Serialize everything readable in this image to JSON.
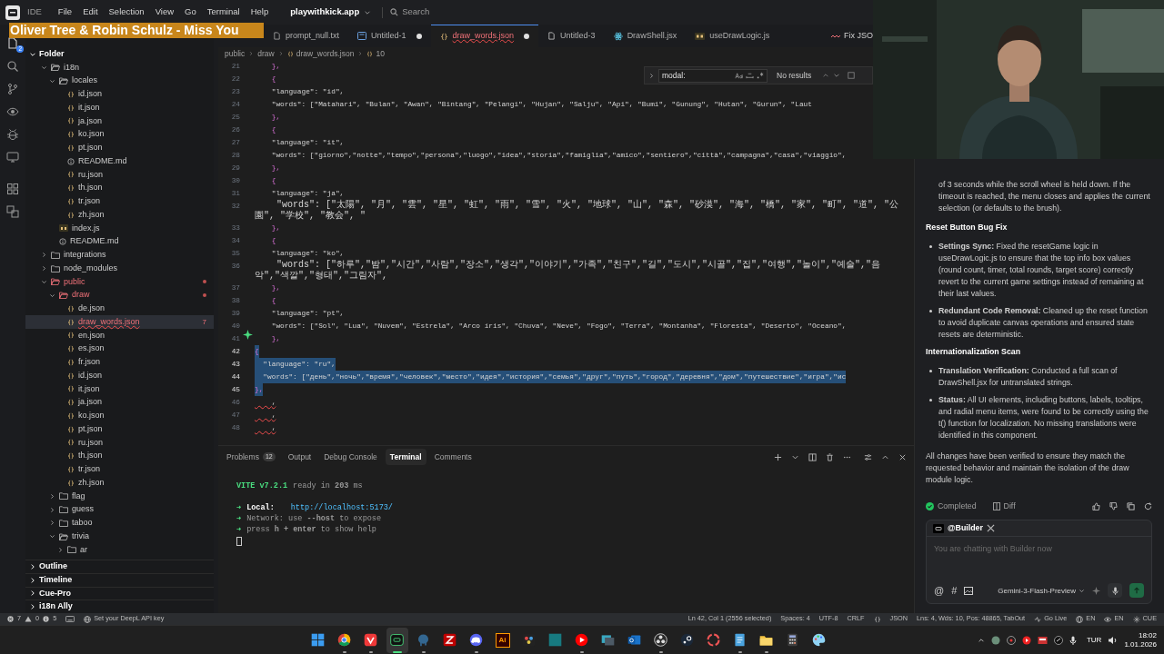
{
  "title_bar": {
    "app_name": "IDE",
    "menus": [
      "File",
      "Edit",
      "Selection",
      "View",
      "Go",
      "Terminal",
      "Help"
    ],
    "workspace": "playwithkick.app",
    "search": {
      "placeholder": "Search"
    }
  },
  "now_playing": {
    "text": "Oliver Tree & Robin Schulz - Miss You"
  },
  "activity_bar": {
    "explorer_badge": "2"
  },
  "sidebar": {
    "title": "Folder",
    "tree": [
      {
        "label": "i18n",
        "kind": "folder",
        "expanded": true,
        "selected": false,
        "error": false,
        "children": [
          {
            "label": "locales",
            "kind": "folder",
            "expanded": true,
            "selected": false,
            "error": false,
            "children": [
              {
                "label": "id.json",
                "kind": "json",
                "selected": false,
                "error": false
              },
              {
                "label": "it.json",
                "kind": "json",
                "selected": false,
                "error": false
              },
              {
                "label": "ja.json",
                "kind": "json",
                "selected": false,
                "error": false
              },
              {
                "label": "ko.json",
                "kind": "json",
                "selected": false,
                "error": false
              },
              {
                "label": "pt.json",
                "kind": "json",
                "selected": false,
                "error": false
              },
              {
                "label": "README.md",
                "kind": "md",
                "selected": false,
                "error": false
              },
              {
                "label": "ru.json",
                "kind": "json",
                "selected": false,
                "error": false
              },
              {
                "label": "th.json",
                "kind": "json",
                "selected": false,
                "error": false
              },
              {
                "label": "tr.json",
                "kind": "json",
                "selected": false,
                "error": false
              },
              {
                "label": "zh.json",
                "kind": "json",
                "selected": false,
                "error": false
              }
            ]
          },
          {
            "label": "index.js",
            "kind": "js",
            "selected": false,
            "error": false
          },
          {
            "label": "README.md",
            "kind": "md",
            "selected": false,
            "error": false
          }
        ]
      },
      {
        "label": "integrations",
        "kind": "folder",
        "expanded": false,
        "selected": false,
        "error": false
      },
      {
        "label": "node_modules",
        "kind": "folder",
        "expanded": false,
        "selected": false,
        "error": false
      },
      {
        "label": "public",
        "kind": "folder",
        "expanded": true,
        "selected": false,
        "error": true,
        "children": [
          {
            "label": "draw",
            "kind": "folder",
            "expanded": true,
            "selected": false,
            "error": true,
            "children": [
              {
                "label": "de.json",
                "kind": "json",
                "selected": false,
                "error": false
              },
              {
                "label": "draw_words.json",
                "kind": "json",
                "selected": true,
                "error": true,
                "badge": "7"
              },
              {
                "label": "en.json",
                "kind": "json",
                "selected": false,
                "error": false
              },
              {
                "label": "es.json",
                "kind": "json",
                "selected": false,
                "error": false
              },
              {
                "label": "fr.json",
                "kind": "json",
                "selected": false,
                "error": false
              },
              {
                "label": "id.json",
                "kind": "json",
                "selected": false,
                "error": false
              },
              {
                "label": "it.json",
                "kind": "json",
                "selected": false,
                "error": false
              },
              {
                "label": "ja.json",
                "kind": "json",
                "selected": false,
                "error": false
              },
              {
                "label": "ko.json",
                "kind": "json",
                "selected": false,
                "error": false
              },
              {
                "label": "pt.json",
                "kind": "json",
                "selected": false,
                "error": false
              },
              {
                "label": "ru.json",
                "kind": "json",
                "selected": false,
                "error": false
              },
              {
                "label": "th.json",
                "kind": "json",
                "selected": false,
                "error": false
              },
              {
                "label": "tr.json",
                "kind": "json",
                "selected": false,
                "error": false
              },
              {
                "label": "zh.json",
                "kind": "json",
                "selected": false,
                "error": false
              }
            ]
          },
          {
            "label": "flag",
            "kind": "folder",
            "expanded": false,
            "selected": false,
            "error": false
          },
          {
            "label": "guess",
            "kind": "folder",
            "expanded": false,
            "selected": false,
            "error": false
          },
          {
            "label": "taboo",
            "kind": "folder",
            "expanded": false,
            "selected": false,
            "error": false
          },
          {
            "label": "trivia",
            "kind": "folder",
            "expanded": true,
            "selected": false,
            "error": false,
            "children": [
              {
                "label": "ar",
                "kind": "folder",
                "expanded": false,
                "selected": false,
                "error": false
              }
            ]
          }
        ]
      }
    ],
    "sections": [
      "Outline",
      "Timeline",
      "Cue-Pro",
      "i18n Ally"
    ]
  },
  "tabs": [
    {
      "label": "prompt_null.txt",
      "kind": "txt",
      "selected": false,
      "modified": false,
      "error": false
    },
    {
      "label": "Untitled-1",
      "kind": "untitled",
      "selected": false,
      "modified": true,
      "error": false
    },
    {
      "label": "draw_words.json",
      "kind": "json",
      "selected": true,
      "modified": true,
      "error": true
    },
    {
      "label": "Untitled-3",
      "kind": "file",
      "selected": false,
      "modified": false,
      "error": false
    },
    {
      "label": "DrawShell.jsx",
      "kind": "react",
      "selected": false,
      "modified": false,
      "error": false
    },
    {
      "label": "useDrawLogic.js",
      "kind": "js",
      "selected": false,
      "modified": false,
      "error": false
    }
  ],
  "tab_bar_action": "Fix JSO",
  "breadcrumb": [
    "public",
    "draw",
    "draw_words.json",
    "10"
  ],
  "find_widget": {
    "value": "modal:",
    "result": "No results"
  },
  "editor": {
    "lines": [
      {
        "number": "21",
        "text": "    },",
        "kind": "brace",
        "selected": false
      },
      {
        "number": "22",
        "text": "    {",
        "kind": "brace",
        "selected": false
      },
      {
        "number": "23",
        "text": "    \"language\": \"id\",",
        "kind": "code",
        "selected": false
      },
      {
        "number": "24",
        "text": "    \"words\": [\"Matahari\", \"Bulan\", \"Awan\", \"Bintang\", \"Pelangi\", \"Hujan\", \"Salju\", \"Api\", \"Bumi\", \"Gunung\", \"Hutan\", \"Gurun\", \"Laut",
        "kind": "code",
        "selected": false
      },
      {
        "number": "25",
        "text": "    },",
        "kind": "brace",
        "selected": false
      },
      {
        "number": "26",
        "text": "    {",
        "kind": "brace",
        "selected": false
      },
      {
        "number": "27",
        "text": "    \"language\": \"it\",",
        "kind": "code",
        "selected": false
      },
      {
        "number": "28",
        "text": "    \"words\": [\"giorno\",\"notte\",\"tempo\",\"persona\",\"luogo\",\"idea\",\"storia\",\"famiglia\",\"amico\",\"sentiero\",\"città\",\"campagna\",\"casa\",\"viaggio\",",
        "kind": "code",
        "selected": false
      },
      {
        "number": "29",
        "text": "    },",
        "kind": "brace",
        "selected": false
      },
      {
        "number": "30",
        "text": "    {",
        "kind": "brace",
        "selected": false
      },
      {
        "number": "31",
        "text": "    \"language\": \"ja\",",
        "kind": "code",
        "selected": false
      },
      {
        "number": "32",
        "text": "    \"words\": [\"太陽\", \"月\", \"雲\", \"星\", \"虹\", \"雨\", \"雪\", \"火\", \"地球\", \"山\", \"森\", \"砂漠\", \"海\", \"橋\", \"家\", \"町\", \"道\", \"公園\", \"学校\", \"教会\", \"",
        "kind": "wide",
        "selected": false
      },
      {
        "number": "33",
        "text": "    },",
        "kind": "brace",
        "selected": false
      },
      {
        "number": "34",
        "text": "    {",
        "kind": "brace",
        "selected": false
      },
      {
        "number": "35",
        "text": "    \"language\": \"ko\",",
        "kind": "code",
        "selected": false
      },
      {
        "number": "36",
        "text": "    \"words\": [\"하루\",\"밤\",\"시간\",\"사람\",\"장소\",\"생각\",\"이야기\",\"가족\",\"친구\",\"길\",\"도시\",\"시골\",\"집\",\"여행\",\"놀이\",\"예술\",\"음악\",\"색깔\",\"형태\",\"그림자\",",
        "kind": "wide",
        "selected": false
      },
      {
        "number": "37",
        "text": "    },",
        "kind": "brace",
        "selected": false
      },
      {
        "number": "38",
        "text": "    {",
        "kind": "brace",
        "selected": false
      },
      {
        "number": "39",
        "text": "    \"language\": \"pt\",",
        "kind": "code",
        "selected": false
      },
      {
        "number": "40",
        "text": "    \"words\": [\"Sol\", \"Lua\", \"Nuvem\", \"Estrela\", \"Arco íris\", \"Chuva\", \"Neve\", \"Fogo\", \"Terra\", \"Montanha\", \"Floresta\", \"Deserto\", \"Oceano\",",
        "kind": "code",
        "selected": false
      },
      {
        "number": "41",
        "text": "    },",
        "kind": "brace",
        "selected": false
      },
      {
        "number": "42",
        "text": "{",
        "kind": "brace",
        "selected": true
      },
      {
        "number": "43",
        "text": "  \"language\": \"ru\",",
        "kind": "code",
        "selected": true
      },
      {
        "number": "44",
        "text": "  \"words\": [\"день\",\"ночь\",\"время\",\"человек\",\"место\",\"идея\",\"история\",\"семья\",\"друг\",\"путь\",\"город\",\"деревня\",\"дом\",\"путешествие\",\"игра\",\"ис",
        "kind": "code",
        "selected": true
      },
      {
        "number": "45",
        "text": "},",
        "kind": "brace",
        "selected": true
      },
      {
        "number": "46",
        "text": "    ,",
        "kind": "error",
        "selected": false
      },
      {
        "number": "47",
        "text": "    ,",
        "kind": "error",
        "selected": false
      },
      {
        "number": "48",
        "text": "    ,",
        "kind": "error",
        "selected": false
      }
    ]
  },
  "panel": {
    "tabs": [
      {
        "label": "Problems",
        "badge": "12",
        "selected": false
      },
      {
        "label": "Output",
        "selected": false
      },
      {
        "label": "Debug Console",
        "selected": false
      },
      {
        "label": "Terminal",
        "selected": true
      },
      {
        "label": "Comments",
        "selected": false
      }
    ],
    "terminal": {
      "version": "VITE v7.2.1",
      "ready": "ready in **203** ms",
      "lines": [
        {
          "arrow": "➜",
          "label": "Local:",
          "link": "http://localhost:5173/"
        },
        {
          "arrow": "➜",
          "text": "Network: use **--host** to expose"
        },
        {
          "arrow": "➜",
          "text": "press **h + enter** to show help"
        }
      ]
    }
  },
  "chat": {
    "blocks": [
      {
        "kind": "continuation",
        "text": "of 3 seconds while the scroll wheel is held down. If the timeout is reached, the menu closes and applies the current selection (or defaults to the brush)."
      },
      {
        "kind": "heading",
        "text": "Reset Button Bug Fix"
      },
      {
        "kind": "bullet",
        "text": "**Settings Sync:** Fixed the resetGame logic in useDrawLogic.js to ensure that the top info box values (round count, timer, total rounds, target score) correctly revert to the current game settings instead of remaining at their last values."
      },
      {
        "kind": "bullet",
        "text": "**Redundant Code Removal:** Cleaned up the reset function to avoid duplicate canvas operations and ensured state resets are deterministic."
      },
      {
        "kind": "heading",
        "text": "Internationalization Scan"
      },
      {
        "kind": "bullet",
        "text": "**Translation Verification:** Conducted a full scan of DrawShell.jsx for untranslated strings."
      },
      {
        "kind": "bullet",
        "text": "**Status:** All UI elements, including buttons, labels, tooltips, and radial menu items, were found to be correctly using the t() function for localization. No missing translations were identified in this component."
      },
      {
        "kind": "paragraph",
        "text": "All changes have been verified to ensure they match the requested behavior and maintain the isolation of the draw module logic."
      }
    ],
    "status": "Completed",
    "diff": "Diff",
    "agent": "@Builder",
    "input_placeholder": "You are chatting with Builder now",
    "input_tools": [
      "@",
      "#"
    ],
    "model": "Gemini-3-Flash-Preview"
  },
  "status_bar": {
    "errors": "7",
    "warnings": "0",
    "infos": "5",
    "notice": "Set your DeepL API key",
    "right": [
      {
        "kind": "text",
        "text": "Ln 42, Col 1 (2556 selected)"
      },
      {
        "kind": "text",
        "text": "Spaces: 4"
      },
      {
        "kind": "text",
        "text": "UTF-8"
      },
      {
        "kind": "text",
        "text": "CRLF"
      },
      {
        "kind": "braces"
      },
      {
        "kind": "text",
        "text": "JSON"
      },
      {
        "kind": "text",
        "text": "Lns: 4, Wds: 10, Pos: 48865, TabOut"
      },
      {
        "kind": "live",
        "text": "Go Live"
      },
      {
        "kind": "globe",
        "text": "EN"
      },
      {
        "kind": "eye",
        "text": "EN"
      },
      {
        "kind": "cue",
        "text": "CUE"
      }
    ]
  },
  "taskbar": {
    "apps": [
      {
        "kind": "windows",
        "selected": false,
        "running": false
      },
      {
        "kind": "chrome",
        "selected": false,
        "running": true
      },
      {
        "kind": "vivaldi",
        "selected": false,
        "running": true
      },
      {
        "kind": "ide",
        "selected": true,
        "running": true
      },
      {
        "kind": "pg",
        "selected": false,
        "running": true
      },
      {
        "kind": "filezilla",
        "selected": false,
        "running": false
      },
      {
        "kind": "discord",
        "selected": false,
        "running": true
      },
      {
        "kind": "ai",
        "label": "Ai",
        "selected": false,
        "running": false
      },
      {
        "kind": "davinci",
        "selected": false,
        "running": false
      },
      {
        "kind": "tile",
        "selected": false,
        "running": false
      },
      {
        "kind": "ytmusic",
        "selected": false,
        "running": true
      },
      {
        "kind": "slides",
        "selected": false,
        "running": false
      },
      {
        "kind": "outlook",
        "selected": false,
        "running": false
      },
      {
        "kind": "obs",
        "selected": false,
        "running": true
      },
      {
        "kind": "steam",
        "selected": false,
        "running": false
      },
      {
        "kind": "tool",
        "selected": false,
        "running": false
      },
      {
        "kind": "notes",
        "selected": false,
        "running": true
      },
      {
        "kind": "folder",
        "selected": false,
        "running": true
      },
      {
        "kind": "calc",
        "selected": false,
        "running": false
      },
      {
        "kind": "paint",
        "selected": false,
        "running": false
      }
    ],
    "language": "TUR",
    "time": "18:02",
    "date": "1.01.2026"
  }
}
